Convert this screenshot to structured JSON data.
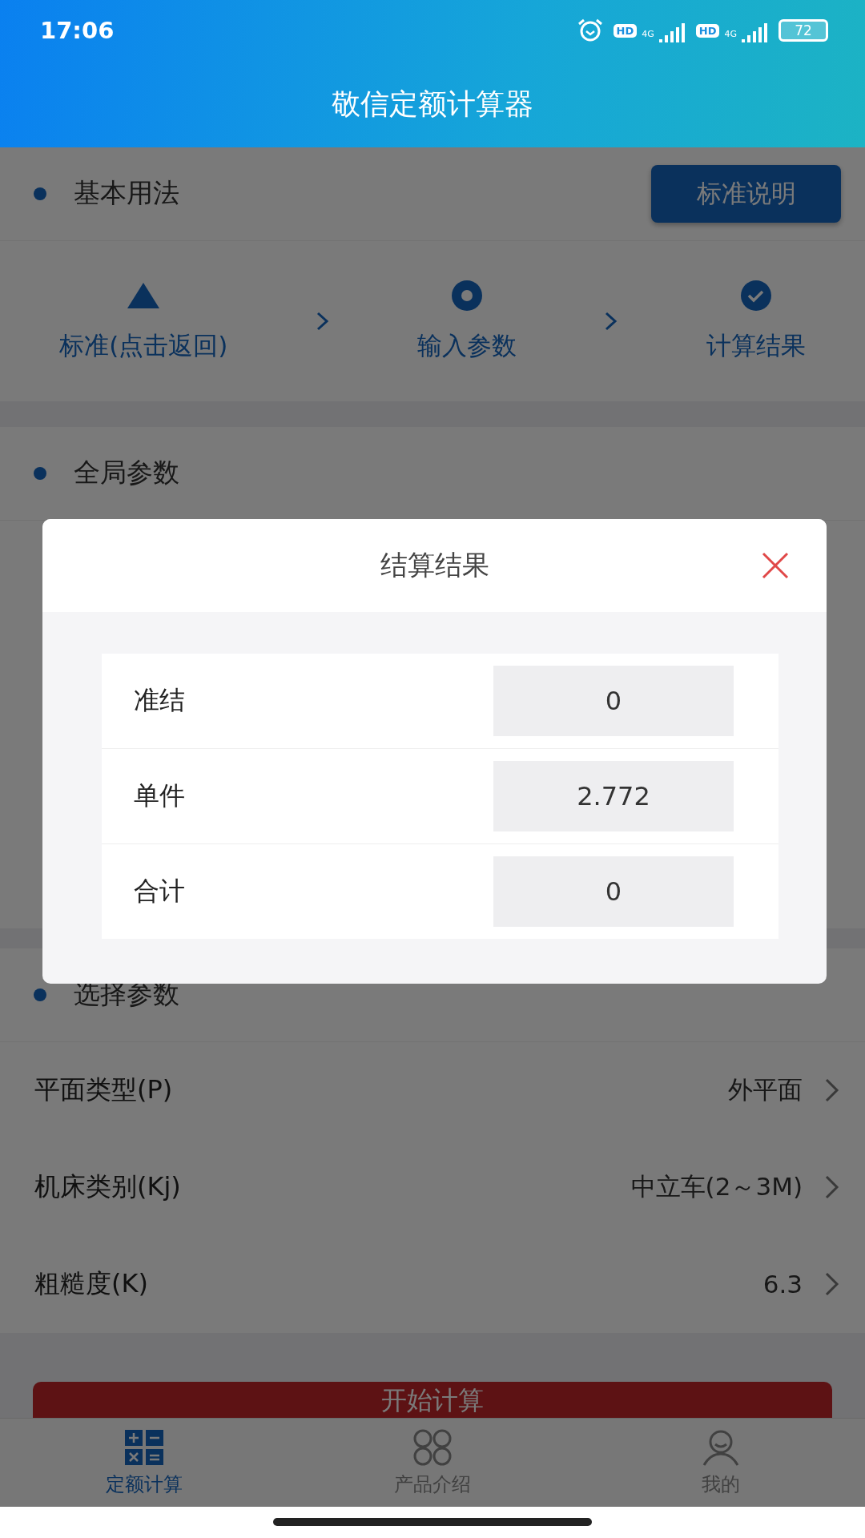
{
  "status_bar": {
    "time": "17:06",
    "battery": "72",
    "sims": [
      {
        "hd": "HD",
        "network": "4G"
      },
      {
        "hd": "HD",
        "network": "4G"
      }
    ]
  },
  "header": {
    "title": "敬信定额计算器"
  },
  "basic_usage": {
    "title": "基本用法",
    "button": "标准说明",
    "steps": [
      {
        "kind": "triangle",
        "label": "标准(点击返回)"
      },
      {
        "kind": "ring",
        "label": "输入参数"
      },
      {
        "kind": "check",
        "label": "计算结果"
      }
    ]
  },
  "global_params": {
    "title": "全局参数"
  },
  "select_params": {
    "title": "选择参数",
    "rows": [
      {
        "label": "平面类型(P)",
        "value": "外平面"
      },
      {
        "label": "机床类别(Kj)",
        "value": "中立车(2～3M)"
      },
      {
        "label": "粗糙度(K)",
        "value": "6.3"
      }
    ]
  },
  "start_button": "开始计算",
  "tab_bar": [
    {
      "kind": "calc",
      "label": "定额计算",
      "selected": true
    },
    {
      "kind": "circles",
      "label": "产品介绍",
      "selected": false
    },
    {
      "kind": "person",
      "label": "我的",
      "selected": false
    }
  ],
  "dialog": {
    "title": "结算结果",
    "rows": [
      {
        "label": "准结",
        "value": "0"
      },
      {
        "label": "单件",
        "value": "2.772"
      },
      {
        "label": "合计",
        "value": "0"
      }
    ]
  }
}
